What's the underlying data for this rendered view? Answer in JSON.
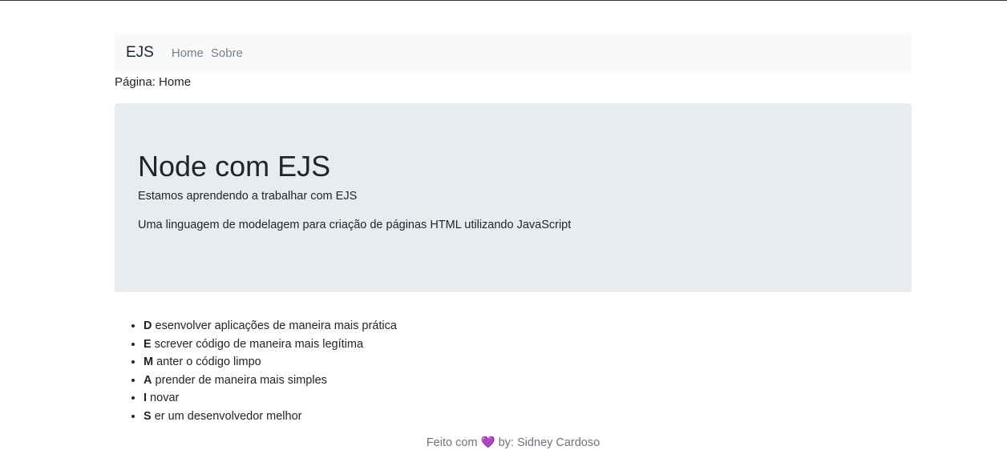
{
  "navbar": {
    "brand": "EJS",
    "links": [
      "Home",
      "Sobre"
    ]
  },
  "page_label": "Página: Home",
  "jumbotron": {
    "title": "Node com EJS",
    "lead": "Estamos aprendendo a trabalhar com EJS",
    "description": "Uma linguagem de modelagem para criação de páginas HTML utilizando JavaScript"
  },
  "features": [
    {
      "letter": "D",
      "rest": " esenvolver aplicações de maneira mais prática"
    },
    {
      "letter": "E",
      "rest": " screver código de maneira mais legítima"
    },
    {
      "letter": "M",
      "rest": " anter o código limpo"
    },
    {
      "letter": "A",
      "rest": " prender de maneira mais simples"
    },
    {
      "letter": "I",
      "rest": " novar"
    },
    {
      "letter": "S",
      "rest": " er um desenvolvedor melhor"
    }
  ],
  "footer": {
    "prefix": "Feito com ",
    "heart": "💜",
    "suffix": " by: Sidney Cardoso"
  }
}
